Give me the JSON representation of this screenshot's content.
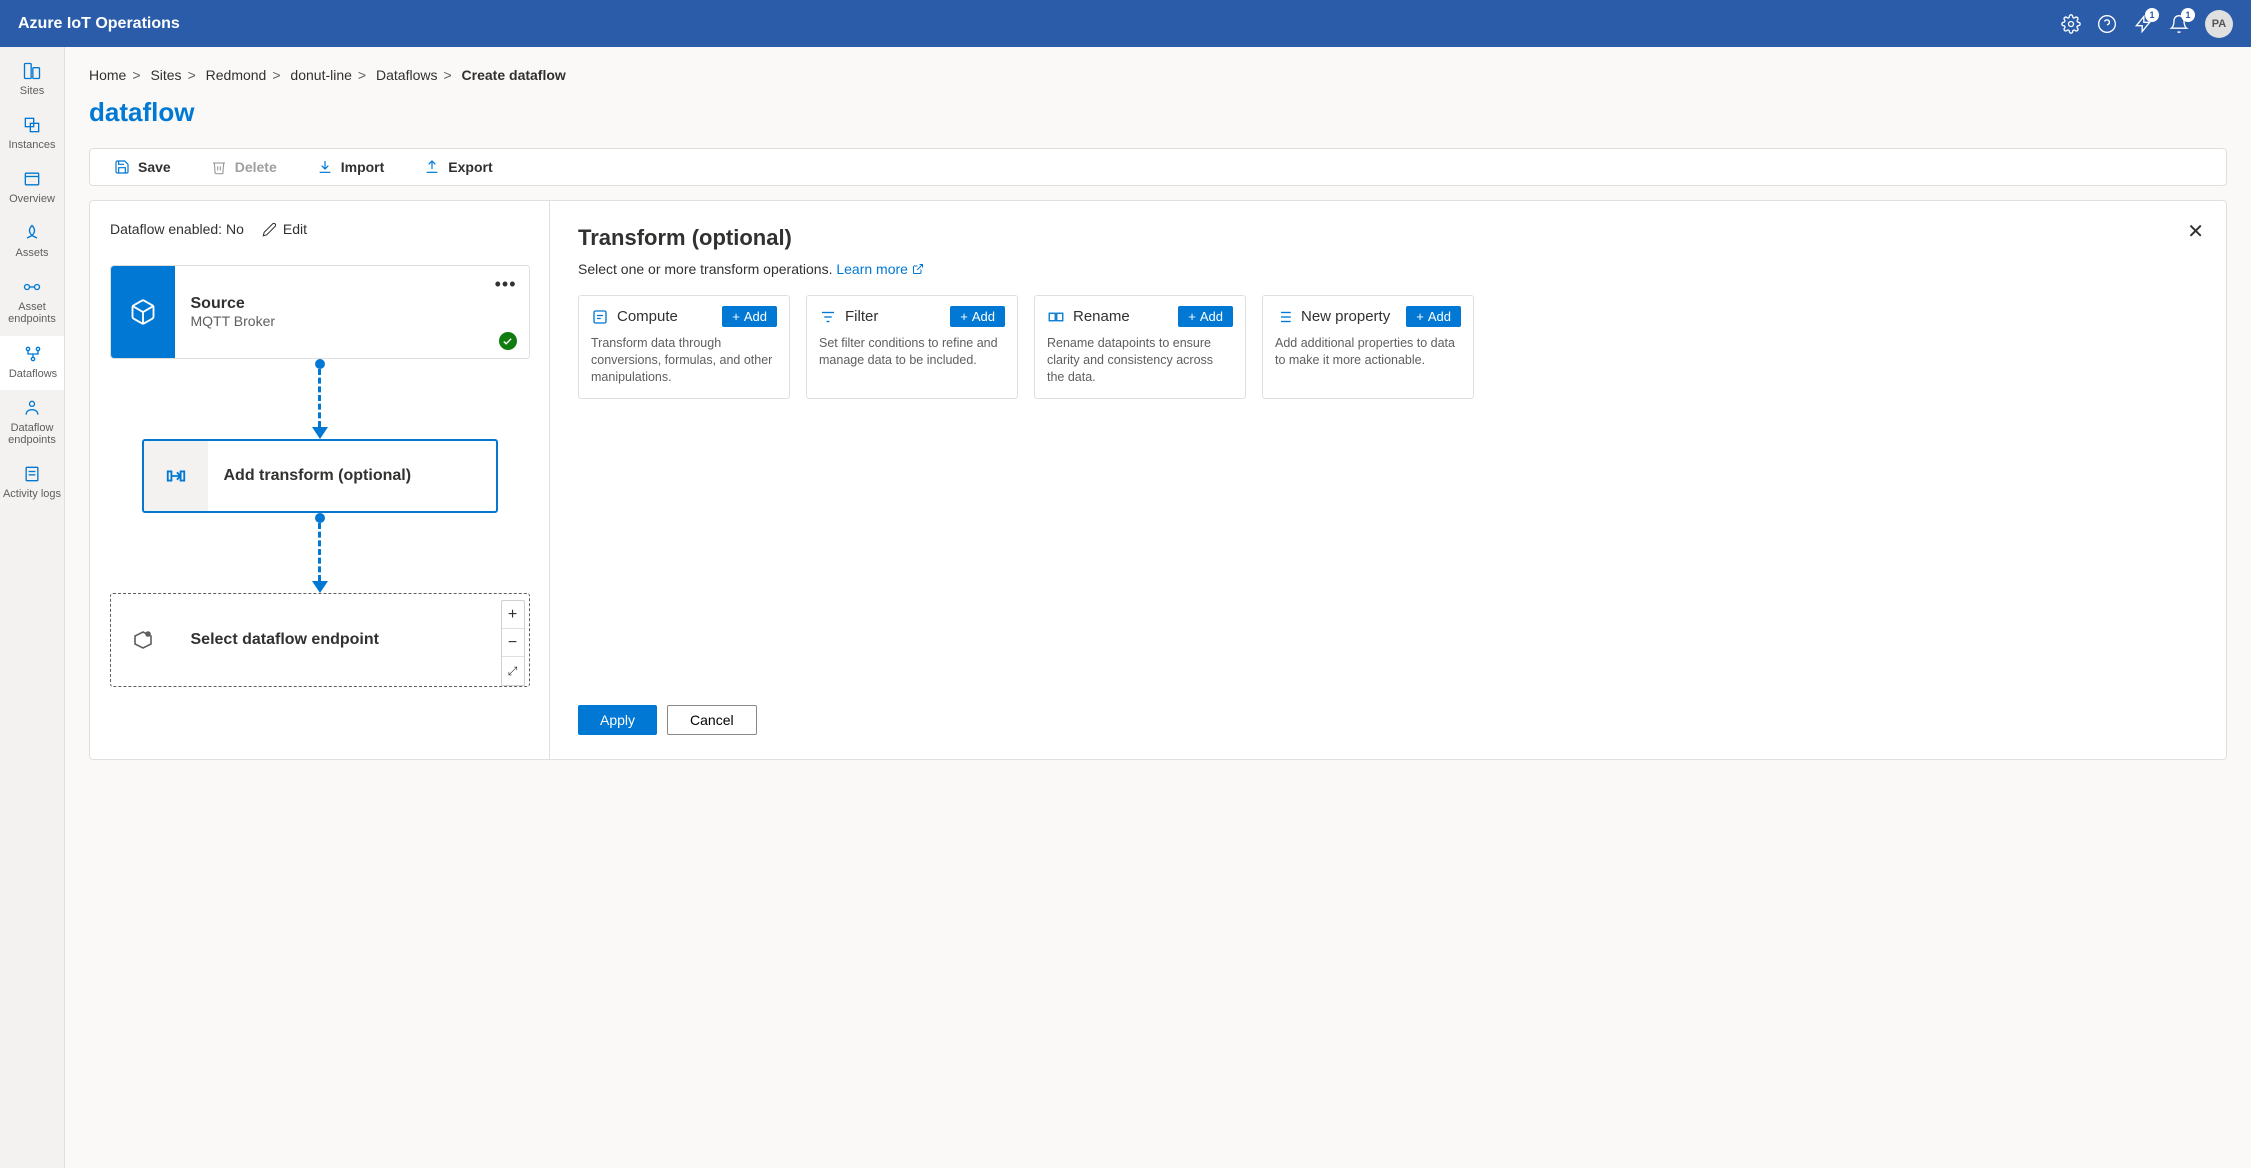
{
  "header": {
    "title": "Azure IoT Operations",
    "bell1_badge": "1",
    "bell2_badge": "1",
    "avatar": "PA"
  },
  "sidebar": {
    "items": [
      {
        "label": "Sites"
      },
      {
        "label": "Instances"
      },
      {
        "label": "Overview"
      },
      {
        "label": "Assets"
      },
      {
        "label": "Asset endpoints"
      },
      {
        "label": "Dataflows"
      },
      {
        "label": "Dataflow endpoints"
      },
      {
        "label": "Activity logs"
      }
    ]
  },
  "breadcrumb": {
    "items": [
      "Home",
      "Sites",
      "Redmond",
      "donut-line",
      "Dataflows"
    ],
    "current": "Create dataflow"
  },
  "page_title": "dataflow",
  "toolbar": {
    "save": "Save",
    "delete": "Delete",
    "import": "Import",
    "export": "Export"
  },
  "enable_row": {
    "label": "Dataflow enabled: No",
    "edit": "Edit"
  },
  "nodes": {
    "source": {
      "title": "Source",
      "subtitle": "MQTT Broker"
    },
    "transform": {
      "title": "Add transform (optional)"
    },
    "dest": {
      "title": "Select dataflow endpoint"
    }
  },
  "right_panel": {
    "title": "Transform (optional)",
    "subtitle_prefix": "Select one or more transform operations. ",
    "learn_more": "Learn more",
    "add_label": "Add",
    "cards": [
      {
        "name": "Compute",
        "desc": "Transform data through conversions, formulas, and other manipulations."
      },
      {
        "name": "Filter",
        "desc": "Set filter conditions to refine and manage data to be included."
      },
      {
        "name": "Rename",
        "desc": "Rename datapoints to ensure clarity and consistency across the data."
      },
      {
        "name": "New property",
        "desc": "Add additional properties to data to make it more actionable."
      }
    ],
    "apply": "Apply",
    "cancel": "Cancel"
  }
}
